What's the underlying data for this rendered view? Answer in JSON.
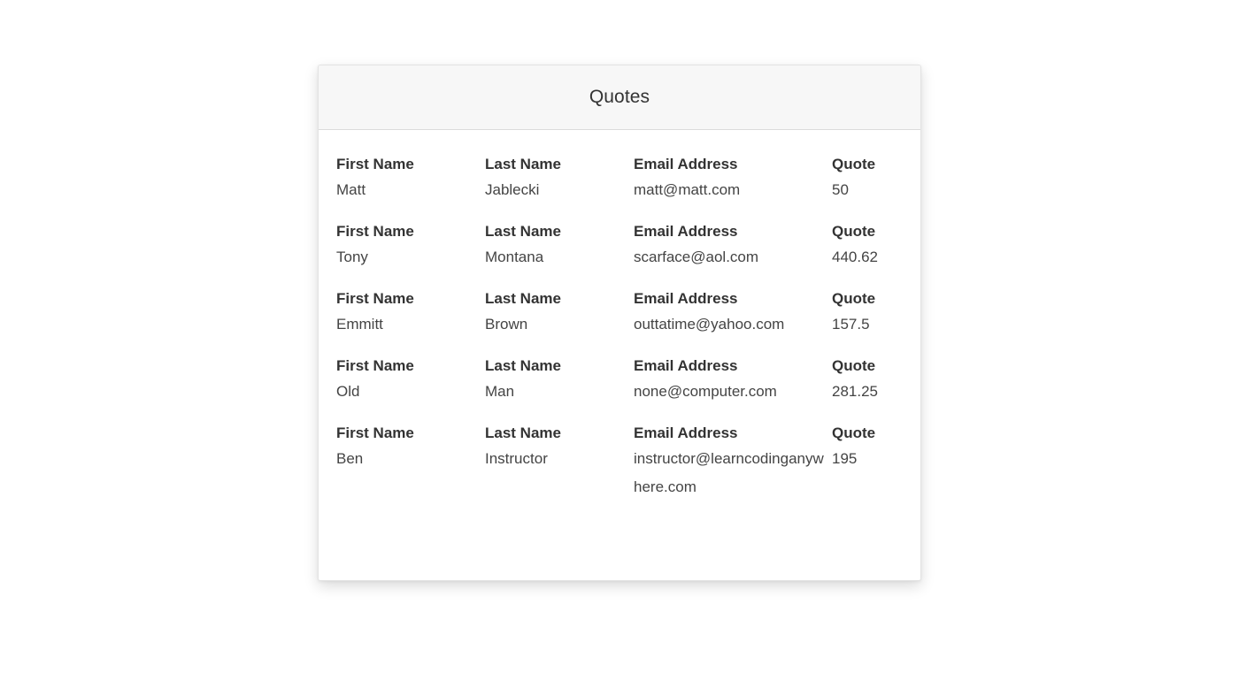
{
  "card": {
    "title": "Quotes"
  },
  "headers": {
    "first_name": "First Name",
    "last_name": "Last Name",
    "email": "Email Address",
    "quote": "Quote"
  },
  "quotes": [
    {
      "first_name": "Matt",
      "last_name": "Jablecki",
      "email": "matt@matt.com",
      "quote": "50"
    },
    {
      "first_name": "Tony",
      "last_name": "Montana",
      "email": "scarface@aol.com",
      "quote": "440.62"
    },
    {
      "first_name": "Emmitt",
      "last_name": "Brown",
      "email": "outtatime@yahoo.com",
      "quote": "157.5"
    },
    {
      "first_name": "Old",
      "last_name": "Man",
      "email": "none@computer.com",
      "quote": "281.25"
    },
    {
      "first_name": "Ben",
      "last_name": "Instructor",
      "email": "instructor@learncodinganywhere.com",
      "quote": "195"
    }
  ]
}
